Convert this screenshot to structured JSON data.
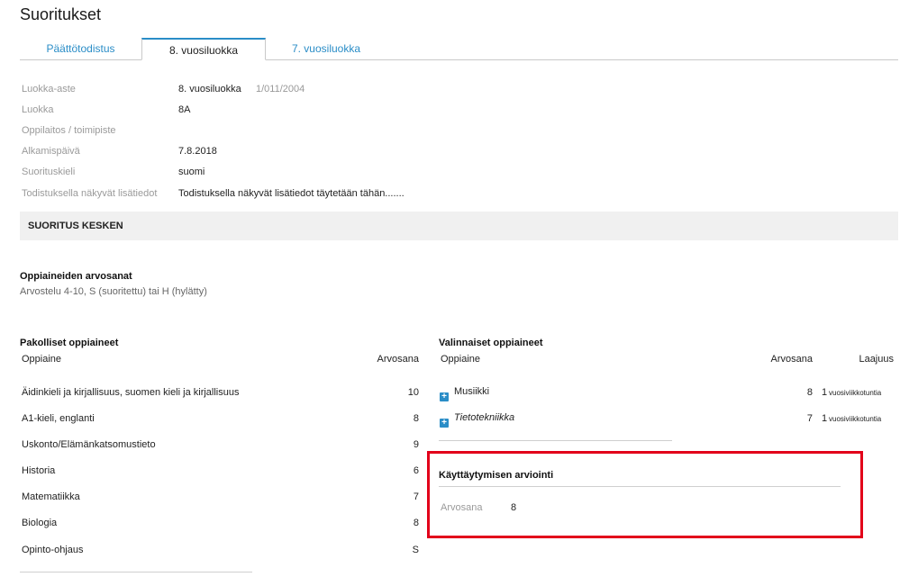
{
  "page": {
    "title": "Suoritukset"
  },
  "tabs": [
    {
      "label": "Päättötodistus"
    },
    {
      "label": "8. vuosiluokka"
    },
    {
      "label": "7. vuosiluokka"
    }
  ],
  "info": {
    "rows": [
      {
        "label": "Luokka-aste",
        "value": "8. vuosiluokka",
        "extra": "1/011/2004"
      },
      {
        "label": "Luokka",
        "value": "8A"
      },
      {
        "label": "Oppilaitos / toimipiste",
        "value": ""
      },
      {
        "label": "Alkamispäivä",
        "value": "7.8.2018"
      },
      {
        "label": "Suorituskieli",
        "value": "suomi"
      },
      {
        "label": "Todistuksella näkyvät lisätiedot",
        "value": "Todistuksella näkyvät lisätiedot täytetään tähän......."
      }
    ]
  },
  "status": {
    "label": "SUORITUS KESKEN"
  },
  "grades": {
    "title": "Oppiaineiden arvosanat",
    "subtitle": "Arvostelu 4-10, S (suoritettu) tai H (hylätty)"
  },
  "mandatory": {
    "title": "Pakolliset oppiaineet",
    "col_subject": "Oppiaine",
    "col_grade": "Arvosana",
    "rows": [
      {
        "subject": "Äidinkieli ja kirjallisuus, suomen kieli ja kirjallisuus",
        "grade": "10"
      },
      {
        "subject": "A1-kieli, englanti",
        "grade": "8"
      },
      {
        "subject": "Uskonto/Elämänkatsomustieto",
        "grade": "9"
      },
      {
        "subject": "Historia",
        "grade": "6"
      },
      {
        "subject": "Matematiikka",
        "grade": "7"
      },
      {
        "subject": "Biologia",
        "grade": "8"
      },
      {
        "subject": "Opinto-ohjaus",
        "grade": "S"
      }
    ]
  },
  "optional": {
    "title": "Valinnaiset oppiaineet",
    "col_subject": "Oppiaine",
    "col_grade": "Arvosana",
    "col_scope": "Laajuus",
    "rows": [
      {
        "subject": "Musiikki",
        "grade": "8",
        "scope_num": "1",
        "scope_unit": "vuosiviikkotuntia"
      },
      {
        "subject": "Tietotekniikka",
        "grade": "7",
        "scope_num": "1",
        "scope_unit": "vuosiviikkotuntia"
      }
    ]
  },
  "behavior": {
    "title": "Käyttäytymisen arviointi",
    "label": "Arvosana",
    "value": "8"
  }
}
